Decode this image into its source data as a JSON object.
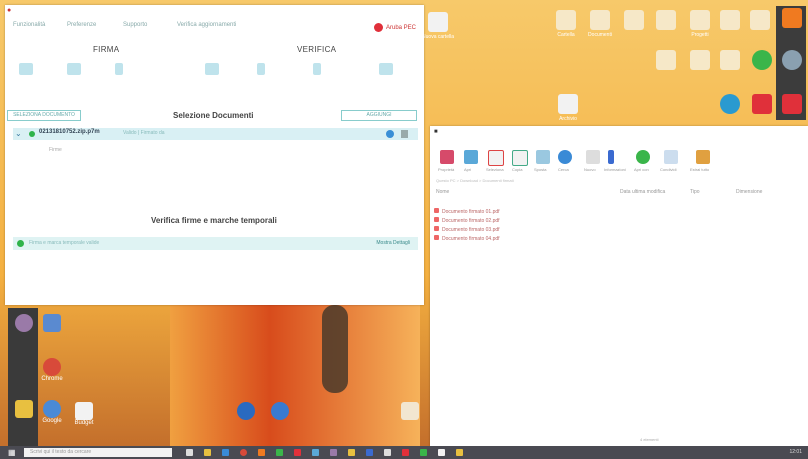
{
  "app": {
    "menu": [
      "Funzionalità",
      "Preferenze",
      "Supporto",
      "Verifica aggiornamenti"
    ],
    "brand": "Aruba PEC",
    "tabs": {
      "firma": "FIRMA",
      "verifica": "VERIFICA"
    },
    "documents_title": "Selezione Documenti",
    "buttons": {
      "left": "SELEZIONA DOCUMENTO",
      "right": "AGGIUNGI"
    },
    "document": {
      "name": "02131810752.zip.p7m",
      "meta": "Valido | Firmato da",
      "sub": "Firme"
    },
    "verify_title": "Verifica firme e marche temporali",
    "verify_row": {
      "text": "Firma e marca temporale valide",
      "link": "Mostra Dettagli"
    }
  },
  "explorer": {
    "ribbon": [
      "Proprietà",
      "Apri",
      "Seleziona",
      "Copia",
      "Sposta",
      "Cerca",
      "Nuovo",
      "Informazioni",
      "Apri con",
      "Condividi",
      "Estrai tutto"
    ],
    "path": "Questo PC > Download > Documenti firmati",
    "columns": {
      "name": "Nome",
      "date": "Data ultima modifica",
      "type": "Tipo",
      "size": "Dimensione"
    },
    "files": [
      "Documento firmato 01.pdf",
      "Documento firmato 02.pdf",
      "Documento firmato 03.pdf",
      "Documento firmato 04.pdf"
    ],
    "status": "4 elementi"
  },
  "desktop": {
    "right_labels": [
      "Nuova cartella",
      "Cartella",
      "Documenti",
      "Progetti",
      "Archivio"
    ],
    "left_labels": [
      "Chrome",
      "Google",
      "Budget"
    ]
  },
  "taskbar": {
    "search_placeholder": "Scrivi qui il testo da cercare",
    "clock": "12:01"
  },
  "colors": {
    "accent": "#3aa0c8",
    "valid": "#2eb34a",
    "brand": "#e0303a"
  }
}
